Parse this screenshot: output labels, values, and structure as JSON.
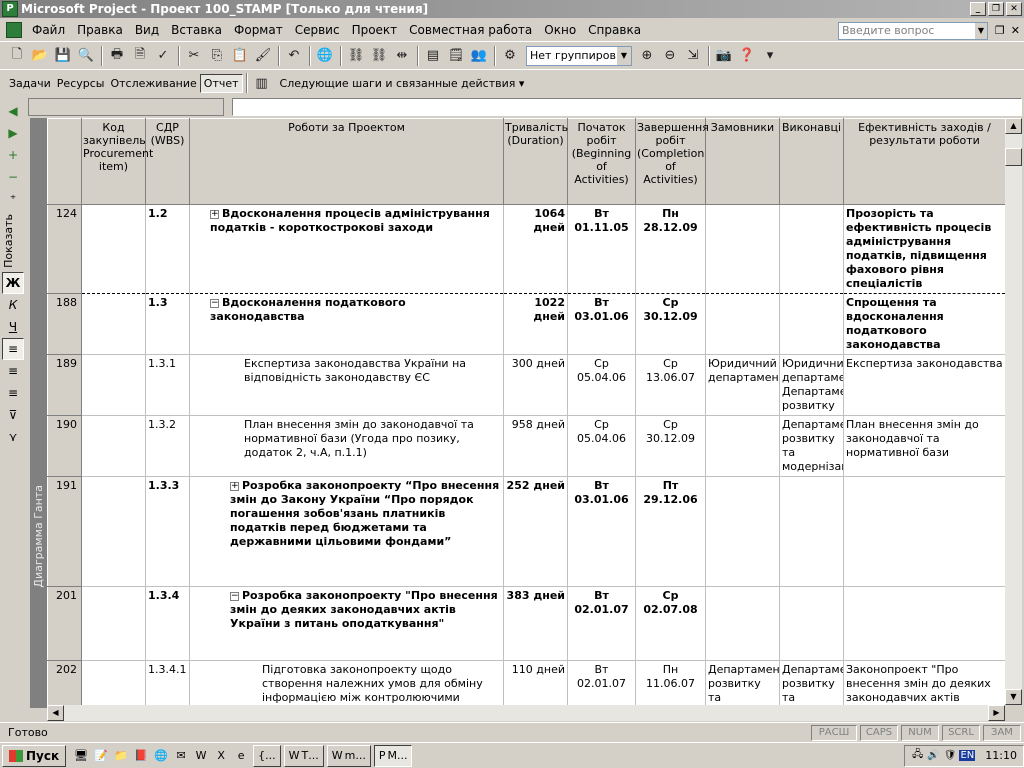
{
  "window": {
    "title": "Microsoft Project - Проект 100_STAMP [Только для чтения]"
  },
  "menu": {
    "items": [
      "Файл",
      "Правка",
      "Вид",
      "Вставка",
      "Формат",
      "Сервис",
      "Проект",
      "Совместная работа",
      "Окно",
      "Справка"
    ],
    "question_placeholder": "Введите вопрос"
  },
  "toolbar": {
    "grouping": "Нет группировки"
  },
  "toolbar2": {
    "tabs": [
      "Задачи",
      "Ресурсы",
      "Отслеживание",
      "Отчет"
    ],
    "active_tab": "Отчет",
    "next_steps": "Следующие шаги и связанные действия"
  },
  "side": {
    "show_label": "Показать",
    "view_label": "Диаграмма Ганта"
  },
  "table": {
    "headers": {
      "code": "Код закупівель Procurement item)",
      "wbs": "СДР (WBS)",
      "name": "Роботи за Проектом",
      "duration": "Тривалість (Duration)",
      "start": "Початок робіт (Beginning of Activities)",
      "finish": "Завершення робіт (Completion of Activities)",
      "customers": "Замовники",
      "executors": "Виконавці",
      "efficiency": "Ефективність заходів / результати роботи"
    },
    "rows": [
      {
        "id": "124",
        "code": "",
        "wbs": "1.2",
        "name": "Вдосконалення процесів адміністрування податків - короткострокові заходи",
        "duration": "1064 дней",
        "start": "Вт 01.11.05",
        "finish": "Пн 28.12.09",
        "customers": "",
        "executors": "",
        "efficiency": "Прозорість та ефективність процесів адміністрування податків, підвищення фахового рівня спеціалістів",
        "summary": true,
        "expander": "+"
      },
      {
        "id": "188",
        "code": "",
        "wbs": "1.3",
        "name": "Вдосконалення податкового законодавства",
        "duration": "1022 дней",
        "start": "Вт 03.01.06",
        "finish": "Ср 30.12.09",
        "customers": "",
        "executors": "",
        "efficiency": "Спрощення та вдосконалення податкового законодавства",
        "summary": true,
        "expander": "−"
      },
      {
        "id": "189",
        "code": "",
        "wbs": "1.3.1",
        "name": "Експертиза законодавства України на відповідність законодавству ЄС",
        "duration": "300 дней",
        "start": "Ср 05.04.06",
        "finish": "Ср 13.06.07",
        "customers": "Юридичний департамент",
        "executors": "Юридичний департамент Департамент розвитку",
        "efficiency": "Експертиза законодавства",
        "summary": false,
        "expander": ""
      },
      {
        "id": "190",
        "code": "",
        "wbs": "1.3.2",
        "name": "План внесення змін до законодавчої та нормативної бази (Угода про позику, додаток 2, ч.А, п.1.1)",
        "duration": "958 дней",
        "start": "Ср 05.04.06",
        "finish": "Ср 30.12.09",
        "customers": "",
        "executors": "Департамент розвитку та модернізації",
        "efficiency": "План внесення змін до законодавчої та нормативної бази",
        "summary": false,
        "expander": ""
      },
      {
        "id": "191",
        "code": "",
        "wbs": "1.3.3",
        "name": "Розробка законопроекту “Про внесення змін до Закону України “Про порядок погашення зобов'язань платників податків перед бюджетами та державними цільовими фондами”",
        "duration": "252 дней",
        "start": "Вт 03.01.06",
        "finish": "Пт 29.12.06",
        "customers": "",
        "executors": "",
        "efficiency": "",
        "summary": true,
        "expander": "+"
      },
      {
        "id": "201",
        "code": "",
        "wbs": "1.3.4",
        "name": "Розробка законопроекту \"Про внесення змін до деяких законодавчих актів України з питань оподаткування\"",
        "duration": "383 дней",
        "start": "Вт 02.01.07",
        "finish": "Ср 02.07.08",
        "customers": "",
        "executors": "",
        "efficiency": "",
        "summary": true,
        "expander": "−"
      },
      {
        "id": "202",
        "code": "",
        "wbs": "1.3.4.1",
        "name": "Підготовка законопроекту щодо створення належних умов для обміну інформацією між контролюючими органами, іншими органами державної влади, банками та іншими суб'єктами з метою забезпечення ефективного",
        "duration": "110 дней",
        "start": "Вт 02.01.07",
        "finish": "Пн 11.06.07",
        "customers": "Департамент розвитку та модернізації ДПС",
        "executors": "Департамент розвитку та модернізації ДПС, Структурні підрозділи ДПА",
        "efficiency": "Законопроект \"Про внесення змін до деяких законодавчих актів України з питань оподаткування\"",
        "summary": false,
        "expander": ""
      }
    ]
  },
  "status": {
    "text": "Готово",
    "indicators": [
      "РАСШ",
      "CAPS",
      "NUM",
      "SCRL",
      "ЗАМ"
    ]
  },
  "taskbar": {
    "start": "Пуск",
    "tasks": [
      "{...",
      "Т...",
      "m...",
      "M..."
    ],
    "clock": "11:10",
    "lang": "EN"
  }
}
